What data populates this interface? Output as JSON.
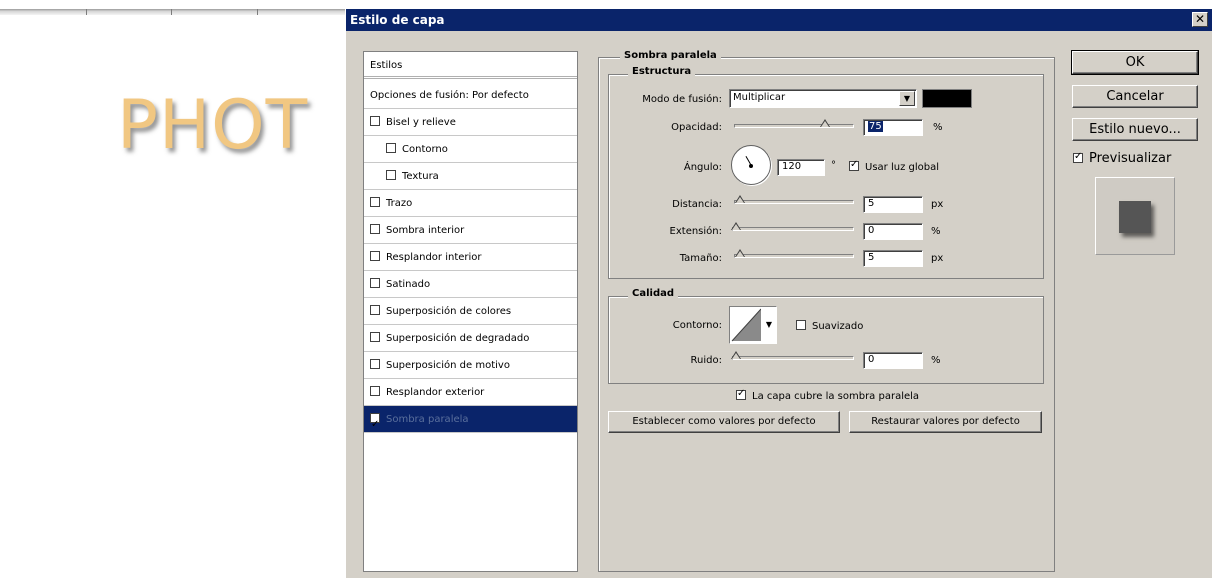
{
  "background": {
    "text": "PHOT"
  },
  "window": {
    "title": "Estilo de capa",
    "close_glyph": "✕"
  },
  "styles_list": {
    "header": "Estilos",
    "blend_options": "Opciones de fusión: Por defecto",
    "items": [
      {
        "label": "Bisel y relieve",
        "checked": false
      },
      {
        "label": "Contorno",
        "checked": false
      },
      {
        "label": "Textura",
        "checked": false
      },
      {
        "label": "Trazo",
        "checked": false
      },
      {
        "label": "Sombra interior",
        "checked": false
      },
      {
        "label": "Resplandor interior",
        "checked": false
      },
      {
        "label": "Satinado",
        "checked": false
      },
      {
        "label": "Superposición de colores",
        "checked": false
      },
      {
        "label": "Superposición de degradado",
        "checked": false
      },
      {
        "label": "Superposición de motivo",
        "checked": false
      },
      {
        "label": "Resplandor exterior",
        "checked": false
      },
      {
        "label": "Sombra paralela",
        "checked": true,
        "selected": true
      }
    ]
  },
  "drop_shadow": {
    "title": "Sombra paralela",
    "structure": {
      "legend": "Estructura",
      "blend_mode_label": "Modo de fusión:",
      "blend_mode_value": "Multiplicar",
      "shadow_color": "#000000",
      "opacity_label": "Opacidad:",
      "opacity_value": "75",
      "opacity_level": 0.75,
      "opacity_unit": "%",
      "angle_label": "Ángulo:",
      "angle_value": "120",
      "angle_unit": "°",
      "global_light_label": "Usar luz global",
      "global_light_checked": true,
      "distance_label": "Distancia:",
      "distance_value": "5",
      "distance_unit": "px",
      "spread_label": "Extensión:",
      "spread_value": "0",
      "spread_unit": "%",
      "size_label": "Tamaño:",
      "size_value": "5",
      "size_unit": "px"
    },
    "quality": {
      "legend": "Calidad",
      "contour_label": "Contorno:",
      "antialias_label": "Suavizado",
      "antialias_checked": false,
      "noise_label": "Ruido:",
      "noise_value": "0",
      "noise_unit": "%"
    },
    "knockout_label": "La capa cubre la sombra paralela",
    "knockout_checked": true,
    "make_default_label": "Establecer como valores por defecto",
    "reset_default_label": "Restaurar valores por defecto"
  },
  "buttons": {
    "ok": "OK",
    "cancel": "Cancelar",
    "new_style": "Estilo nuevo...",
    "preview_label": "Previsualizar",
    "preview_checked": true
  }
}
